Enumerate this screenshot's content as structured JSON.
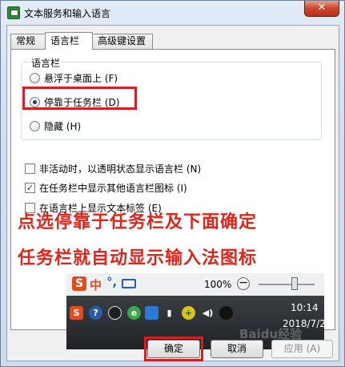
{
  "window": {
    "title": "文本服务和输入语言",
    "close_glyph": "✕"
  },
  "tabs": [
    {
      "label": "常规",
      "active": false
    },
    {
      "label": "语言栏",
      "active": true
    },
    {
      "label": "高级键设置",
      "active": false
    }
  ],
  "language_bar_group": {
    "title": "语言栏",
    "options": [
      {
        "label": "悬浮于桌面上 (F)",
        "selected": false
      },
      {
        "label": "停靠于任务栏 (D)",
        "selected": true
      },
      {
        "label": "隐藏 (H)",
        "selected": false
      }
    ]
  },
  "checkboxes": [
    {
      "label": "非活动时，以透明状态显示语言栏 (N)",
      "checked": false
    },
    {
      "label": "在任务栏中显示其他语言栏图标 (I)",
      "checked": true
    },
    {
      "label": "在语言栏上显示文本标签 (E)",
      "checked": false
    }
  ],
  "annotation": {
    "line1": "点选停靠于任务栏及下面确定",
    "line2": "任务栏就自动显示输入法图标",
    "color": "#e1251b"
  },
  "taskbar_preview": {
    "ime_s": "S",
    "ime_lang": "中",
    "ime_punct": "°,",
    "zoom": "100%",
    "zoom_minus": "−",
    "time": "10:14",
    "date": "2018/7/2",
    "tray_icons": [
      "sogou-icon",
      "help-icon",
      "qq-icon",
      "sync-icon",
      "shield-icon",
      "signal-icon",
      "plus-icon",
      "volume-icon",
      "penguin-icon"
    ]
  },
  "buttons": {
    "ok": "确定",
    "cancel": "取消",
    "apply": "应用 (A)"
  },
  "watermark": "Baidu经验"
}
